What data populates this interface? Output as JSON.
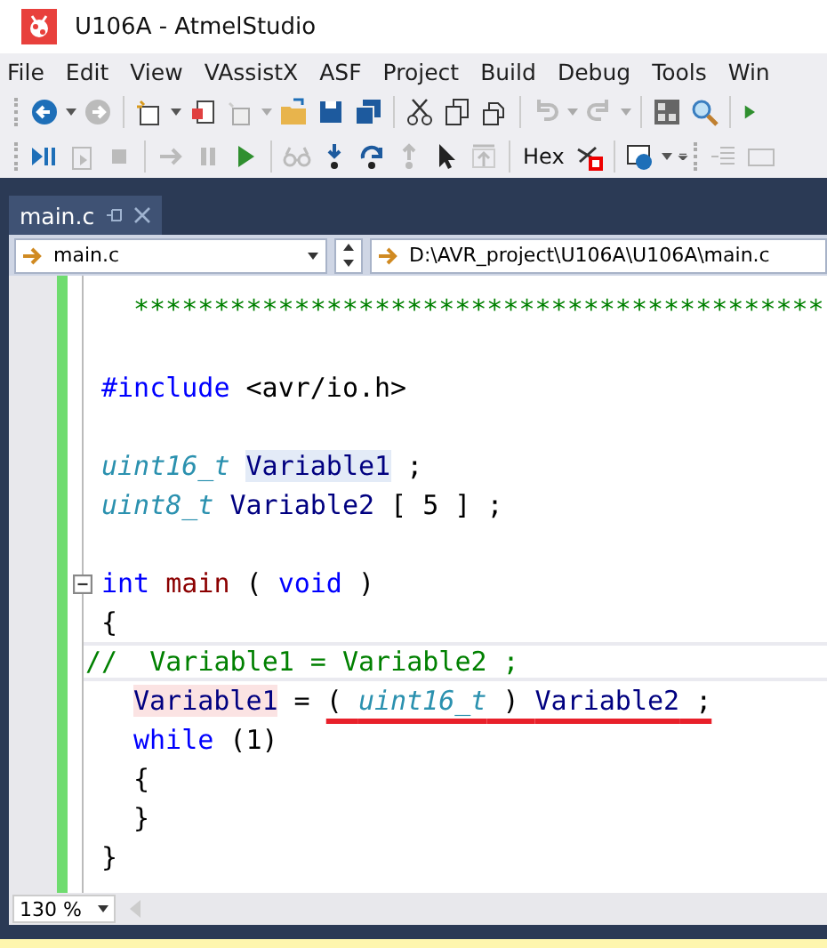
{
  "window": {
    "title": "U106A - AtmelStudio"
  },
  "menu": [
    "File",
    "Edit",
    "View",
    "VAssistX",
    "ASF",
    "Project",
    "Build",
    "Debug",
    "Tools",
    "Win"
  ],
  "toolbar": {
    "hex_label": "Hex"
  },
  "tabs": [
    {
      "label": "main.c",
      "selected": true
    }
  ],
  "navigation": {
    "scope": "main.c",
    "path": "D:\\AVR_project\\U106A\\U106A\\main.c"
  },
  "editor": {
    "lines": [
      {
        "kind": "code",
        "indented": true,
        "tokens": [
          {
            "kind": "comment",
            "text": "*******************************************"
          }
        ]
      },
      {
        "kind": "blank"
      },
      {
        "kind": "code",
        "tokens": [
          {
            "kind": "keyword",
            "text": "#include"
          },
          {
            "kind": "plain",
            "text": " <avr/io.h>"
          }
        ]
      },
      {
        "kind": "blank"
      },
      {
        "kind": "code",
        "tokens": [
          {
            "kind": "type",
            "text": "uint16_t "
          },
          {
            "kind": "variable",
            "text": "Variable1",
            "reference_highlight": true
          },
          {
            "kind": "plain",
            "text": " ;"
          }
        ]
      },
      {
        "kind": "code",
        "tokens": [
          {
            "kind": "type",
            "text": "uint8_t "
          },
          {
            "kind": "variable",
            "text": "Variable2"
          },
          {
            "kind": "plain",
            "text": " [ 5 ] ;"
          }
        ]
      },
      {
        "kind": "blank"
      },
      {
        "kind": "code",
        "foldable": true,
        "tokens": [
          {
            "kind": "keyword",
            "text": "int "
          },
          {
            "kind": "function",
            "text": "main"
          },
          {
            "kind": "plain",
            "text": " ( "
          },
          {
            "kind": "keyword",
            "text": "void"
          },
          {
            "kind": "plain",
            "text": " )"
          }
        ]
      },
      {
        "kind": "code",
        "tokens": [
          {
            "kind": "plain",
            "text": "{"
          }
        ]
      },
      {
        "kind": "code",
        "current": true,
        "tokens": [
          {
            "kind": "comment",
            "text": "//  Variable1 = Variable2 ;"
          }
        ]
      },
      {
        "kind": "code",
        "indented": true,
        "tokens": [
          {
            "kind": "variable",
            "text": "Variable1",
            "error_highlight": true
          },
          {
            "kind": "plain",
            "text": " = "
          },
          {
            "kind": "plain",
            "text": "( ",
            "underlined": true
          },
          {
            "kind": "type",
            "text": "uint16_t",
            "underlined": true
          },
          {
            "kind": "plain",
            "text": " ) ",
            "underlined": true
          },
          {
            "kind": "variable",
            "text": "Variable2",
            "underlined": true
          },
          {
            "kind": "plain",
            "text": " ;",
            "underlined": true
          }
        ]
      },
      {
        "kind": "code",
        "indented": true,
        "tokens": [
          {
            "kind": "keyword",
            "text": "while"
          },
          {
            "kind": "plain",
            "text": " (1)"
          }
        ]
      },
      {
        "kind": "code",
        "indented": true,
        "tokens": [
          {
            "kind": "plain",
            "text": "{"
          }
        ]
      },
      {
        "kind": "code",
        "indented": true,
        "tokens": [
          {
            "kind": "plain",
            "text": "}"
          }
        ]
      },
      {
        "kind": "code",
        "tokens": [
          {
            "kind": "plain",
            "text": "}"
          }
        ]
      }
    ]
  },
  "zoom": {
    "value": "130 %"
  }
}
